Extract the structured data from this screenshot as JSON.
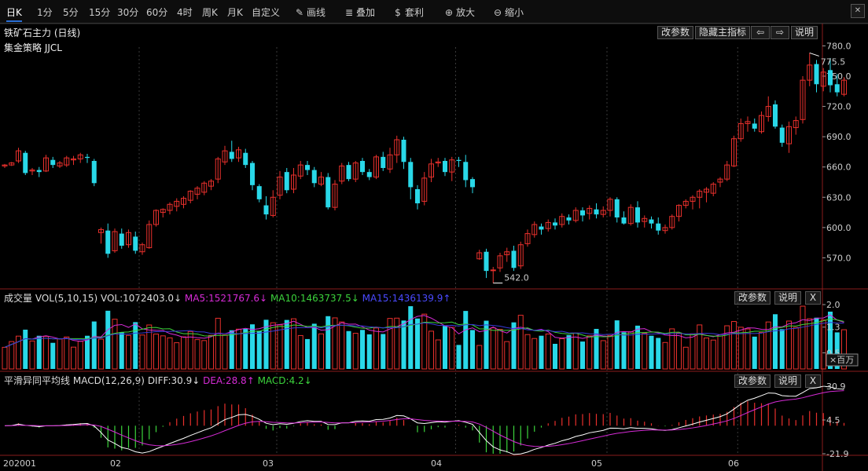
{
  "toolbar": {
    "periods": [
      "日K",
      "1分",
      "5分",
      "15分",
      "30分",
      "60分",
      "4时",
      "周K",
      "月K",
      "自定义"
    ],
    "active_period": "日K",
    "tools": [
      {
        "icon": "pencil-icon",
        "glyph": "✎",
        "label": "画线"
      },
      {
        "icon": "layers-icon",
        "glyph": "≣",
        "label": "叠加"
      },
      {
        "icon": "money-bag-icon",
        "glyph": "$",
        "label": "套利"
      },
      {
        "icon": "zoom-in-icon",
        "glyph": "⊕",
        "label": "放大"
      },
      {
        "icon": "zoom-out-icon",
        "glyph": "⊖",
        "label": "缩小"
      }
    ],
    "close_glyph": "✕"
  },
  "main_pane": {
    "title": "铁矿石主力 (日线)",
    "strategy": "集金策略 JJCL",
    "buttons": {
      "params": "改参数",
      "hide": "隐藏主指标",
      "left_glyph": "⇦",
      "right_glyph": "⇨",
      "help": "说明"
    },
    "y_ticks": [
      "780.0",
      "750.0",
      "720.0",
      "690.0",
      "660.0",
      "630.0",
      "600.0",
      "570.0"
    ],
    "high_label": "775.5",
    "low_label": "542.0"
  },
  "vol_pane": {
    "title": "成交量",
    "indicator": "VOL(5,10,15)",
    "vol_text": "VOL:1072403.0↓",
    "ma5_text": "MA5:1521767.6↓",
    "ma10_text": "MA10:1463737.5↓",
    "ma15_text": "MA15:1436139.9↑",
    "buttons": {
      "params": "改参数",
      "help": "说明",
      "close": "X"
    },
    "y_ticks": [
      "2.0",
      "1.3",
      "0.5"
    ],
    "unit": "×百万"
  },
  "macd_pane": {
    "title": "平滑异同平均线",
    "indicator": "MACD(12,26,9)",
    "diff_text": "DIFF:30.9↓",
    "dea_text": "DEA:28.8↑",
    "macd_text": "MACD:4.2↓",
    "buttons": {
      "params": "改参数",
      "help": "说明",
      "close": "X"
    },
    "y_ticks": [
      "30.9",
      "4.5",
      "-21.9"
    ]
  },
  "x_axis": [
    "202001",
    "02",
    "03",
    "04",
    "05",
    "06"
  ],
  "colors": {
    "up": "#e8302c",
    "down": "#29d8e8",
    "ma5": "#d62bd6",
    "ma10": "#3cd43c",
    "ma15": "#3a3ad8",
    "diff": "#ffffff",
    "dea": "#d62bd6",
    "long": "#3cd43c",
    "short": "#e8302c"
  },
  "chart_data": {
    "type": "candlestick",
    "candles": [
      [
        661,
        662,
        659,
        663
      ],
      [
        662,
        664,
        661,
        665
      ],
      [
        666,
        676,
        664,
        679
      ],
      [
        674,
        654,
        652,
        676
      ],
      [
        656,
        657,
        652,
        659
      ],
      [
        657,
        655,
        650,
        660
      ],
      [
        656,
        669,
        655,
        672
      ],
      [
        667,
        662,
        659,
        670
      ],
      [
        661,
        664,
        659,
        666
      ],
      [
        662,
        669,
        660,
        671
      ],
      [
        667,
        668,
        662,
        671
      ],
      [
        668,
        672,
        664,
        674
      ],
      [
        670,
        669,
        664,
        673
      ],
      [
        666,
        644,
        641,
        668
      ],
      [
        595,
        598,
        584,
        600
      ],
      [
        597,
        574,
        570,
        604
      ],
      [
        577,
        596,
        575,
        599
      ],
      [
        594,
        582,
        579,
        599
      ],
      [
        583,
        595,
        580,
        598
      ],
      [
        591,
        577,
        574,
        596
      ],
      [
        576,
        583,
        573,
        585
      ],
      [
        580,
        603,
        579,
        607
      ],
      [
        603,
        617,
        601,
        618
      ],
      [
        615,
        618,
        610,
        619
      ],
      [
        617,
        623,
        613,
        625
      ],
      [
        621,
        626,
        616,
        629
      ],
      [
        623,
        629,
        619,
        631
      ],
      [
        627,
        636,
        624,
        637
      ],
      [
        633,
        639,
        628,
        641
      ],
      [
        635,
        644,
        632,
        646
      ],
      [
        641,
        646,
        637,
        648
      ],
      [
        648,
        668,
        644,
        670
      ],
      [
        665,
        676,
        662,
        681
      ],
      [
        675,
        668,
        665,
        686
      ],
      [
        669,
        677,
        665,
        680
      ],
      [
        674,
        662,
        659,
        678
      ],
      [
        664,
        642,
        637,
        666
      ],
      [
        641,
        628,
        625,
        643
      ],
      [
        622,
        613,
        608,
        631
      ],
      [
        612,
        630,
        610,
        637
      ],
      [
        632,
        650,
        628,
        656
      ],
      [
        655,
        637,
        634,
        659
      ],
      [
        638,
        652,
        634,
        659
      ],
      [
        651,
        662,
        648,
        666
      ],
      [
        662,
        657,
        652,
        666
      ],
      [
        657,
        644,
        640,
        660
      ],
      [
        643,
        650,
        641,
        655
      ],
      [
        650,
        620,
        618,
        654
      ],
      [
        620,
        643,
        617,
        647
      ],
      [
        646,
        661,
        643,
        664
      ],
      [
        662,
        648,
        646,
        665
      ],
      [
        648,
        664,
        645,
        666
      ],
      [
        666,
        655,
        652,
        669
      ],
      [
        655,
        650,
        647,
        658
      ],
      [
        650,
        670,
        648,
        672
      ],
      [
        670,
        659,
        656,
        675
      ],
      [
        658,
        672,
        654,
        679
      ],
      [
        672,
        687,
        664,
        691
      ],
      [
        687,
        665,
        658,
        690
      ],
      [
        665,
        640,
        628,
        669
      ],
      [
        638,
        624,
        618,
        642
      ],
      [
        626,
        649,
        622,
        655
      ],
      [
        650,
        663,
        645,
        668
      ],
      [
        664,
        665,
        660,
        669
      ],
      [
        666,
        655,
        651,
        669
      ],
      [
        655,
        667,
        646,
        670
      ],
      [
        667,
        666,
        660,
        670
      ],
      [
        665,
        647,
        640,
        672
      ],
      [
        648,
        640,
        634,
        650
      ],
      [
        569,
        575,
        568,
        578
      ],
      [
        576,
        557,
        550,
        579
      ],
      [
        558,
        558,
        545,
        561
      ],
      [
        560,
        572,
        556,
        575
      ],
      [
        573,
        576,
        566,
        580
      ],
      [
        577,
        560,
        557,
        582
      ],
      [
        562,
        583,
        559,
        586
      ],
      [
        584,
        594,
        581,
        598
      ],
      [
        593,
        603,
        590,
        606
      ],
      [
        601,
        598,
        593,
        604
      ],
      [
        599,
        605,
        596,
        608
      ],
      [
        605,
        602,
        598,
        609
      ],
      [
        603,
        611,
        600,
        614
      ],
      [
        610,
        607,
        603,
        613
      ],
      [
        607,
        617,
        605,
        620
      ],
      [
        617,
        612,
        606,
        620
      ],
      [
        614,
        619,
        608,
        622
      ],
      [
        618,
        613,
        609,
        624
      ],
      [
        613,
        617,
        610,
        621
      ],
      [
        617,
        628,
        611,
        630
      ],
      [
        628,
        610,
        605,
        630
      ],
      [
        610,
        604,
        603,
        616
      ],
      [
        604,
        620,
        602,
        623
      ],
      [
        620,
        605,
        600,
        626
      ],
      [
        606,
        609,
        600,
        612
      ],
      [
        608,
        604,
        599,
        611
      ],
      [
        604,
        597,
        593,
        610
      ],
      [
        597,
        600,
        594,
        603
      ],
      [
        600,
        611,
        598,
        613
      ],
      [
        611,
        622,
        606,
        623
      ],
      [
        622,
        626,
        619,
        628
      ],
      [
        626,
        630,
        618,
        632
      ],
      [
        630,
        636,
        619,
        638
      ],
      [
        635,
        638,
        625,
        640
      ],
      [
        634,
        643,
        631,
        645
      ],
      [
        645,
        648,
        640,
        650
      ],
      [
        648,
        662,
        646,
        666
      ],
      [
        661,
        688,
        660,
        691
      ],
      [
        688,
        703,
        685,
        708
      ],
      [
        703,
        705,
        695,
        710
      ],
      [
        703,
        698,
        695,
        708
      ],
      [
        695,
        711,
        693,
        715
      ],
      [
        710,
        720,
        705,
        730
      ],
      [
        722,
        700,
        698,
        726
      ],
      [
        699,
        684,
        680,
        702
      ],
      [
        683,
        700,
        674,
        705
      ],
      [
        699,
        706,
        692,
        710
      ],
      [
        707,
        746,
        703,
        750
      ],
      [
        746,
        761,
        740,
        773
      ],
      [
        762,
        742,
        734,
        766
      ],
      [
        740,
        754,
        735,
        758
      ],
      [
        756,
        741,
        734,
        768
      ],
      [
        742,
        734,
        730,
        752
      ],
      [
        732,
        746,
        730,
        749
      ]
    ],
    "volume_scale_millions": [
      0,
      2.0
    ],
    "macd_range": [
      -21.9,
      30.9
    ]
  }
}
